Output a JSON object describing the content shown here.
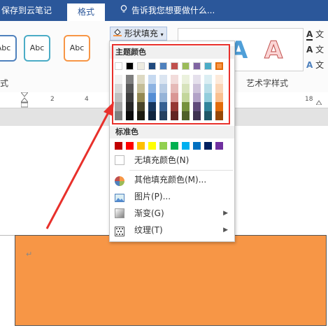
{
  "titlebar": {
    "save_to_cloud": "保存到云笔记",
    "tab_format": "格式",
    "tell_me": "告诉我您想要做什么..."
  },
  "ribbon": {
    "shape_style_sample": "Abc",
    "shape_fill_label": "形状填充",
    "group_label_left": "式",
    "art_group_label": "艺术字样式",
    "art_letter": "A",
    "text_label": "文"
  },
  "ruler": {
    "ticks": [
      "2",
      "4",
      "18"
    ]
  },
  "dropdown": {
    "theme_colors_header": "主题颜色",
    "standard_colors_header": "标准色",
    "no_fill": "无填充颜色(N)",
    "more_fill": "其他填充颜色(M)...",
    "picture": "图片(P)...",
    "gradient": "渐变(G)",
    "texture": "纹理(T)",
    "theme_top_row": [
      "#ffffff",
      "#000000",
      "#eeece1",
      "#1f497d",
      "#4f81bd",
      "#c0504d",
      "#9bbb59",
      "#8064a2",
      "#4bacc6",
      "#f79646"
    ],
    "theme_shades": [
      [
        "#f2f2f2",
        "#7f7f7f",
        "#ddd9c3",
        "#c6d9f0",
        "#dbe5f1",
        "#f2dcdb",
        "#ebf1dd",
        "#e5e0ec",
        "#dbeef3",
        "#fdeada"
      ],
      [
        "#d8d8d8",
        "#595959",
        "#c4bd97",
        "#8db3e2",
        "#b8cce4",
        "#e5b9b7",
        "#d7e3bc",
        "#ccc1d9",
        "#b7dde8",
        "#fbd5b5"
      ],
      [
        "#bfbfbf",
        "#3f3f3f",
        "#938953",
        "#548dd4",
        "#95b3d7",
        "#d99694",
        "#c3d69b",
        "#b2a2c7",
        "#92cddc",
        "#fac08f"
      ],
      [
        "#a5a5a5",
        "#262626",
        "#494429",
        "#17365d",
        "#366092",
        "#953734",
        "#76923c",
        "#5f497a",
        "#31859b",
        "#e36c09"
      ],
      [
        "#7f7f7f",
        "#0c0c0c",
        "#1d1b10",
        "#0f243e",
        "#244061",
        "#632423",
        "#4f6128",
        "#3f3151",
        "#205867",
        "#974806"
      ]
    ],
    "standard_colors": [
      "#c00000",
      "#ff0000",
      "#ffc000",
      "#ffff00",
      "#92d050",
      "#00b050",
      "#00b0f0",
      "#0070c0",
      "#002060",
      "#7030a0"
    ]
  },
  "document": {
    "shape_fill_color": "#f79646",
    "para_mark": "↵"
  }
}
